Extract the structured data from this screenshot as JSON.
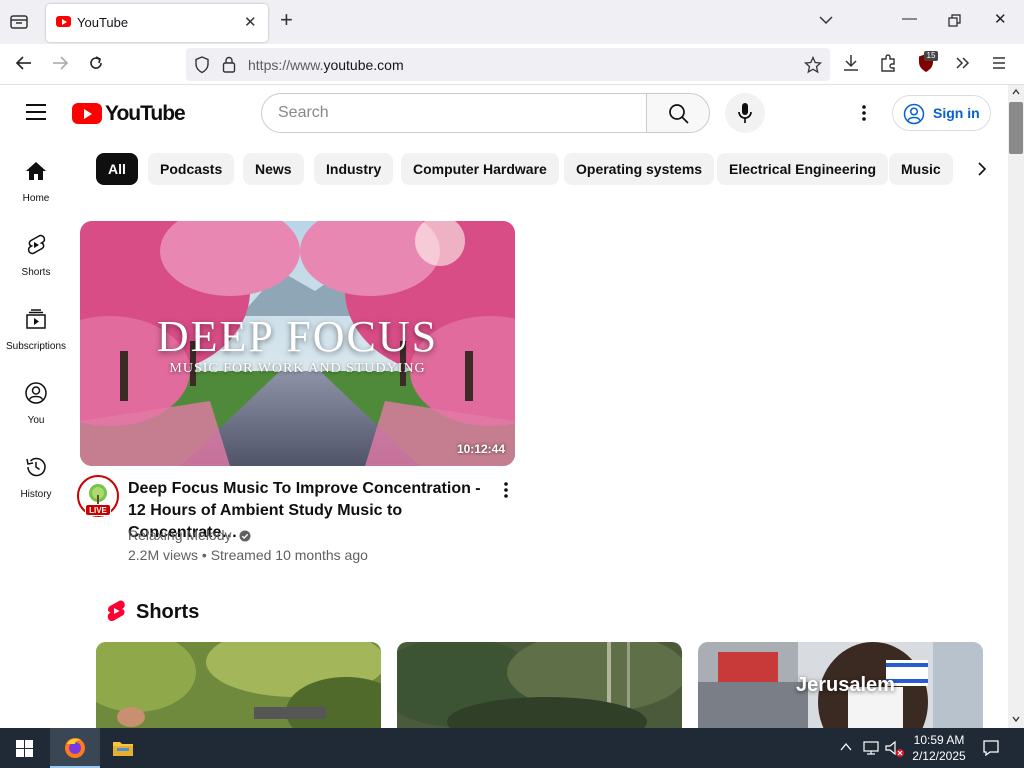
{
  "browser": {
    "tab_title": "YouTube",
    "url_prefix": "https://www.",
    "url_domain": "youtube.com",
    "extension_badge": "15"
  },
  "youtube": {
    "logo_text": "YouTube",
    "search_placeholder": "Search",
    "sign_in": "Sign in",
    "sidebar": [
      {
        "label": "Home",
        "icon": "home-icon"
      },
      {
        "label": "Shorts",
        "icon": "shorts-icon"
      },
      {
        "label": "Subscriptions",
        "icon": "subscriptions-icon"
      },
      {
        "label": "You",
        "icon": "user-icon"
      },
      {
        "label": "History",
        "icon": "history-icon"
      }
    ],
    "chips": [
      "All",
      "Podcasts",
      "News",
      "Industry",
      "Computer Hardware",
      "Operating systems",
      "Electrical Engineering",
      "Music"
    ],
    "video": {
      "thumb_title": "DEEP FOCUS",
      "thumb_subtitle": "MUSIC FOR WORK  AND STUDYING",
      "duration": "10:12:44",
      "title": "Deep Focus Music To Improve Concentration - 12 Hours of Ambient Study Music to Concentrate…",
      "channel": "Relaxing Melody",
      "meta": "2.2M views • Streamed 10 months ago",
      "live_badge": "LIVE"
    },
    "shorts": {
      "heading": "Shorts",
      "items": [
        {
          "caption": ""
        },
        {
          "caption": ""
        },
        {
          "caption": "Jerusalem"
        }
      ]
    }
  },
  "taskbar": {
    "time": "10:59 AM",
    "date": "2/12/2025"
  }
}
